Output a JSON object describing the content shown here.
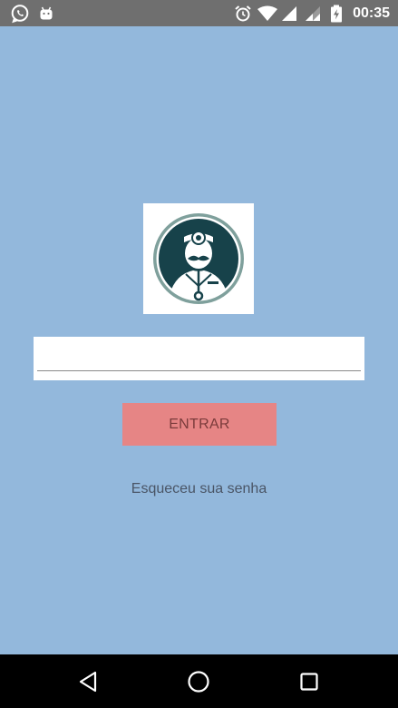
{
  "status_bar": {
    "time": "00:35",
    "left_icons": [
      "whatsapp-icon",
      "android-icon"
    ],
    "right_icons": [
      "alarm-icon",
      "wifi-icon",
      "signal-icon",
      "signal-icon",
      "battery-charging-icon"
    ],
    "background": "#6f6f6f"
  },
  "login": {
    "logo_icon": "doctor-logo-icon",
    "username_value": "",
    "enter_label": "ENTRAR",
    "forgot_label": "Esqueceu sua senha"
  },
  "nav_bar": {
    "buttons": [
      "back-icon",
      "home-icon",
      "recents-icon"
    ]
  },
  "colors": {
    "background": "#93b8dc",
    "button": "#e68585",
    "button_text": "#7a3b3b",
    "logo_dark": "#17424a",
    "logo_ring": "#7fa09c"
  }
}
